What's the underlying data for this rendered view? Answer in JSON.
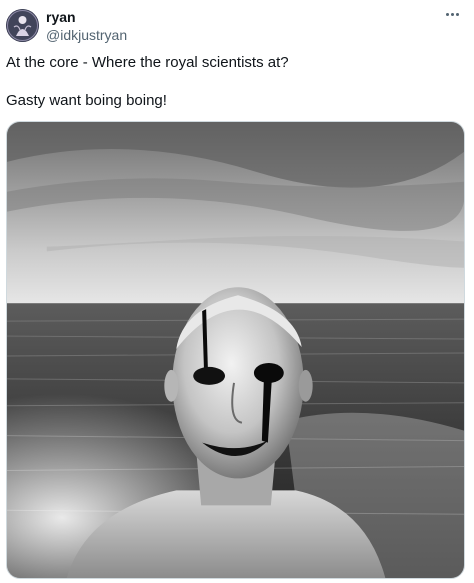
{
  "tweet": {
    "author": {
      "display_name": "ryan",
      "handle": "@idkjustryan",
      "avatar_icon": "avatar-illustration"
    },
    "text_lines": [
      "At the core - Where the royal scientists at?",
      "Gasty want boing boing!"
    ],
    "more_icon": "ellipsis-icon",
    "media": {
      "kind": "photo",
      "palette": "black-and-white"
    }
  }
}
